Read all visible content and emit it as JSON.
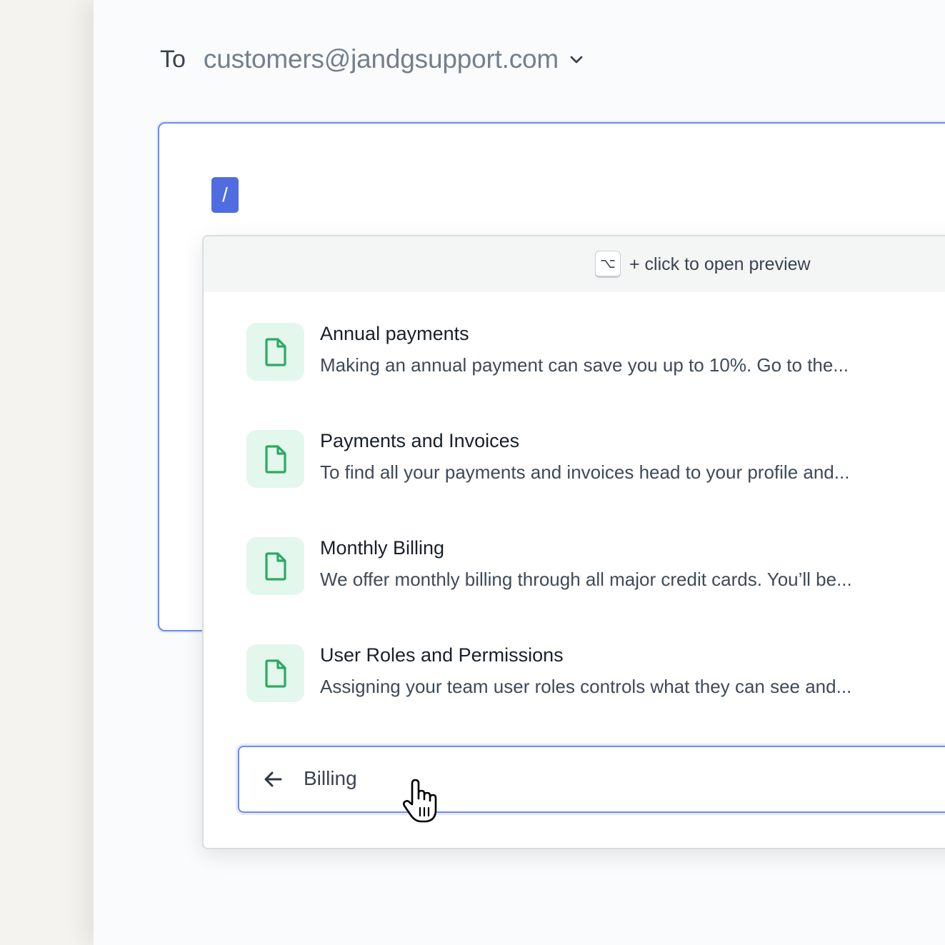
{
  "compose": {
    "to_label": "To",
    "to_address": "customers@jandgsupport.com",
    "slash_command": "/"
  },
  "popup": {
    "hint_key": "⌥",
    "hint_text": "+ click to open preview",
    "results": [
      {
        "title": "Annual payments",
        "description": "Making an annual payment can save you up to 10%. Go to the...",
        "icon": "document-icon"
      },
      {
        "title": "Payments and Invoices",
        "description": "To find all your payments and invoices head to your profile and...",
        "icon": "document-icon"
      },
      {
        "title": "Monthly Billing",
        "description": "We offer monthly billing through all major credit cards. You’ll be...",
        "icon": "document-icon"
      },
      {
        "title": "User Roles and Permissions",
        "description": "Assigning your team user roles controls what they can see and...",
        "icon": "document-icon"
      }
    ],
    "search": {
      "back_icon": "arrow-left-icon",
      "value": "Billing"
    }
  },
  "colors": {
    "accent": "#4f6de0",
    "focus_border": "#6d8cf0",
    "doc_icon": "#2ea866",
    "doc_icon_bg": "#e3f7ec"
  }
}
